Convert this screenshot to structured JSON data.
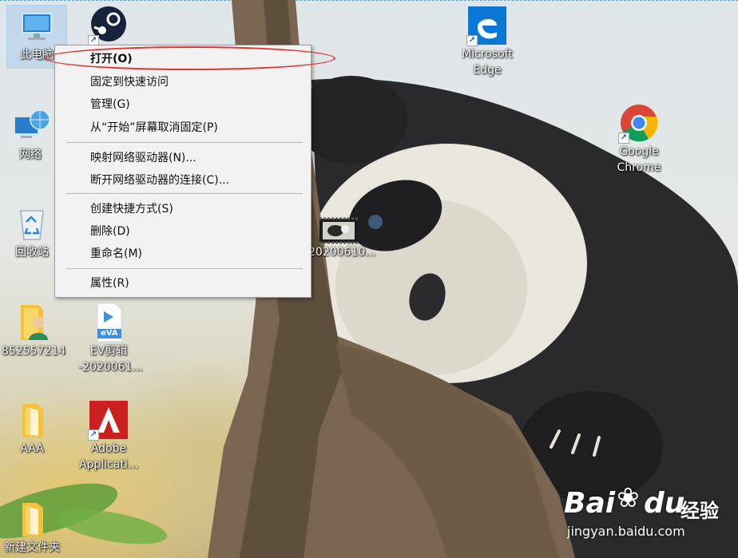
{
  "desktop": {
    "icons": [
      {
        "label": "此电脑",
        "icon": "computer-icon"
      },
      {
        "label": "网络",
        "icon": "network-icon"
      },
      {
        "label": "回收站",
        "icon": "recycle-bin-icon"
      },
      {
        "label": "852557214",
        "icon": "user-folder-icon"
      },
      {
        "label": "AAA",
        "icon": "folder-icon"
      },
      {
        "label": "新建文件夹",
        "icon": "folder-icon"
      },
      {
        "label": "EV剪辑\n-2020061...",
        "icon": "ev-video-file-icon"
      },
      {
        "label": "Adobe\nApplicati...",
        "icon": "adobe-icon"
      },
      {
        "label": "Microsoft\nEdge",
        "icon": "edge-icon"
      },
      {
        "label": "Google\nChrome",
        "icon": "chrome-icon"
      },
      {
        "label": "20200610...",
        "icon": "video-thumbnail-icon"
      }
    ],
    "ev_badge": "eVA"
  },
  "context_menu": {
    "items": [
      {
        "label": "打开(O)",
        "bold": true
      },
      {
        "label": "固定到快速访问"
      },
      {
        "label": "管理(G)"
      },
      {
        "label": "从“开始”屏幕取消固定(P)"
      },
      {
        "label": "映射网络驱动器(N)..."
      },
      {
        "label": "断开网络驱动器的连接(C)..."
      },
      {
        "label": "创建快捷方式(S)"
      },
      {
        "label": "删除(D)"
      },
      {
        "label": "重命名(M)"
      },
      {
        "label": "属性(R)"
      }
    ]
  },
  "watermark": {
    "brand": "Bai",
    "brand2": "du",
    "brand_cn": "经验",
    "url": "jingyan.baidu.com"
  },
  "colors": {
    "highlight": "#e0352f",
    "menu_bg": "#f2f2f2",
    "edge_blue": "#0a78d4",
    "adobe_red": "#cc1f1f"
  }
}
